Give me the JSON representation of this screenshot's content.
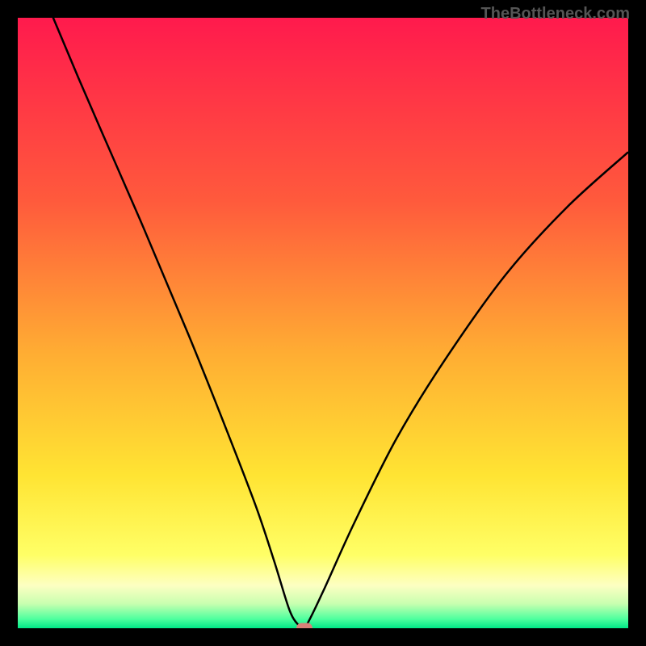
{
  "watermark": "TheBottleneck.com",
  "chart_data": {
    "type": "line",
    "title": "",
    "xlabel": "",
    "ylabel": "",
    "xlim": [
      0,
      100
    ],
    "ylim": [
      0,
      100
    ],
    "series": [
      {
        "name": "bottleneck-curve",
        "x": [
          0,
          10,
          20,
          28,
          34,
          39,
          42,
          44.5,
          46,
          47,
          50,
          55,
          62,
          70,
          80,
          90,
          100
        ],
        "y": [
          114,
          90,
          67,
          48,
          33,
          20,
          11,
          3,
          0.5,
          0,
          6,
          17,
          31,
          44,
          58,
          69,
          78
        ]
      }
    ],
    "marker": {
      "x": 47,
      "y": 0
    },
    "gradient_stops": [
      {
        "pos": 0,
        "color": "#ff1a4d"
      },
      {
        "pos": 30,
        "color": "#ff5a3c"
      },
      {
        "pos": 55,
        "color": "#ffad33"
      },
      {
        "pos": 75,
        "color": "#ffe433"
      },
      {
        "pos": 88,
        "color": "#ffff66"
      },
      {
        "pos": 93,
        "color": "#fdffc2"
      },
      {
        "pos": 96,
        "color": "#c8ffb0"
      },
      {
        "pos": 98.5,
        "color": "#4dff9e"
      },
      {
        "pos": 100,
        "color": "#00e887"
      }
    ]
  }
}
